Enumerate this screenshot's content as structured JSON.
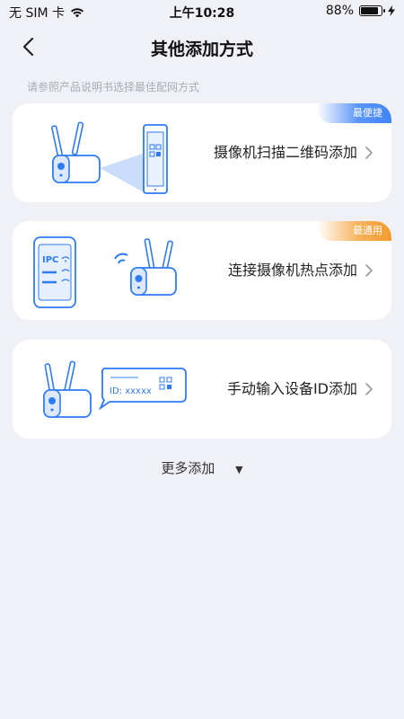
{
  "status": {
    "carrier": "无 SIM 卡",
    "time": "上午10:28",
    "battery_percent": "88%",
    "battery_level": 0.88
  },
  "nav": {
    "title": "其他添加方式"
  },
  "hint": "请参照产品说明书选择最佳配网方式",
  "options": [
    {
      "label": "摄像机扫描二维码添加",
      "badge": "最便捷",
      "icon": "camera-scan-qr-illustration"
    },
    {
      "label": "连接摄像机热点添加",
      "badge": "最通用",
      "icon": "phone-camera-hotspot-illustration"
    },
    {
      "label": "手动输入设备ID添加",
      "badge": "",
      "icon": "camera-device-id-illustration"
    }
  ],
  "illustration_text": {
    "ipc": "IPC",
    "id_placeholder": "ID: xxxxx"
  },
  "more": {
    "label": "更多添加"
  },
  "colors": {
    "background": "#F0F1F7",
    "accent_blue": "#3F84F8",
    "accent_orange": "#F39A2E"
  }
}
